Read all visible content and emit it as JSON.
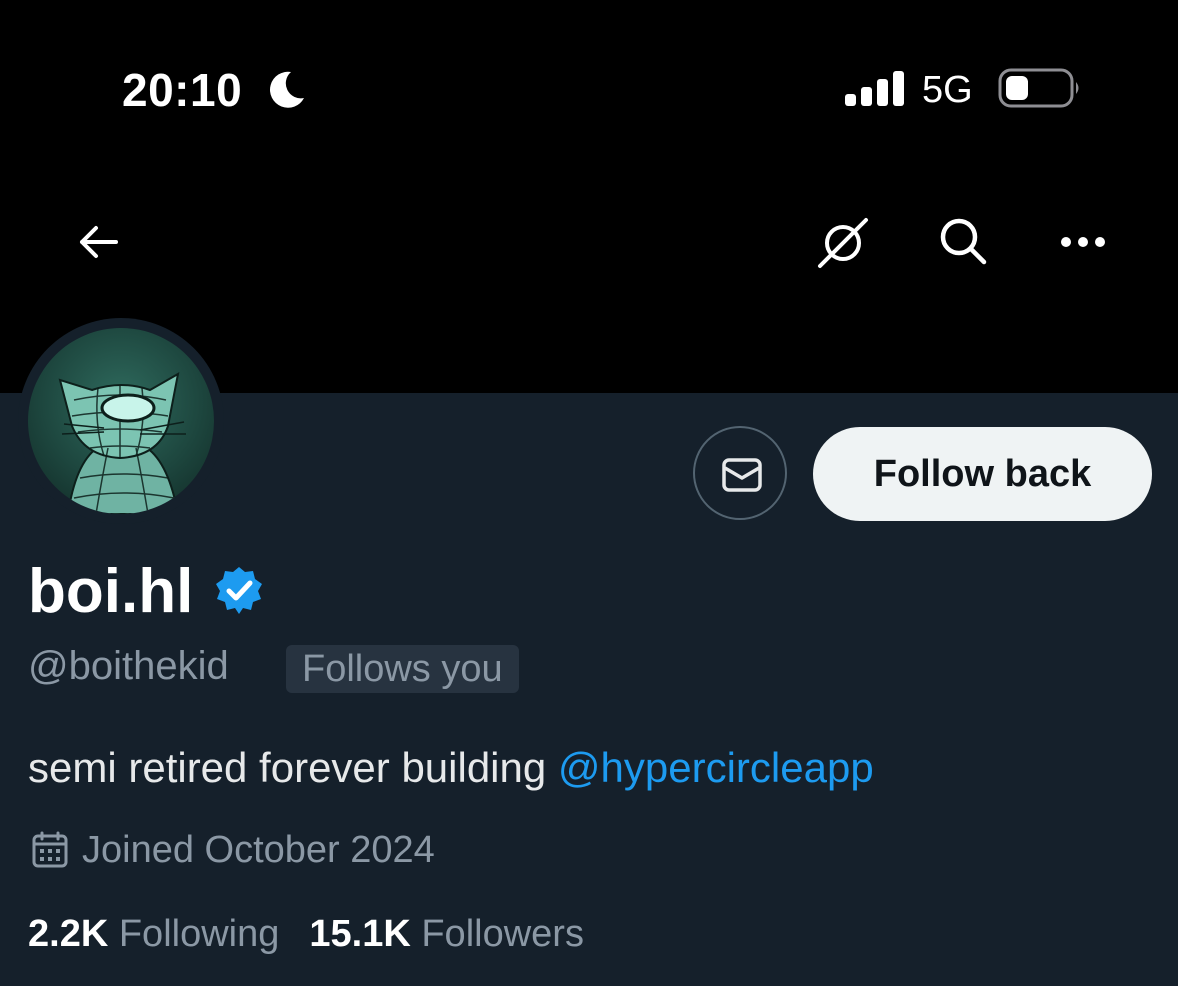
{
  "status_bar": {
    "time": "20:10",
    "network": "5G",
    "icons": [
      "moon-icon",
      "signal-icon",
      "battery-icon"
    ]
  },
  "nav": {
    "icons": [
      "back-arrow-icon",
      "notifications-off-icon",
      "search-icon",
      "more-icon"
    ]
  },
  "profile": {
    "display_name": "boi.hl",
    "verified": true,
    "handle": "@boithekid",
    "follows_you_badge": "Follows you",
    "bio_text": "semi retired forever building ",
    "bio_mention": "@hypercircleapp",
    "joined": "Joined October 2024",
    "following_count": "2.2K",
    "following_label": "Following",
    "followers_count": "15.1K",
    "followers_label": "Followers"
  },
  "actions": {
    "follow_back_label": "Follow back",
    "message_icon": "envelope-icon"
  },
  "colors": {
    "background": "#15202b",
    "banner": "#000000",
    "accent": "#1d9bf0",
    "muted_text": "#8b98a5",
    "follow_button_bg": "#eff3f4"
  }
}
